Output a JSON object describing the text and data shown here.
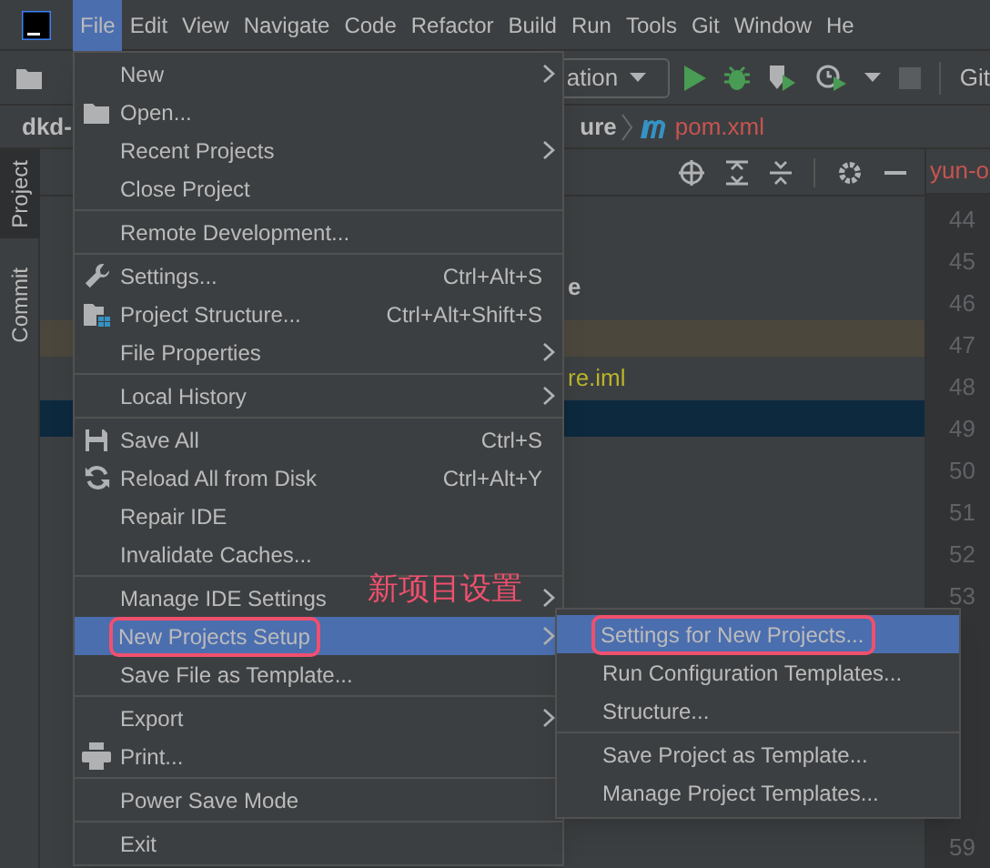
{
  "menubar": [
    {
      "label": "File",
      "selected": true
    },
    {
      "label": "Edit",
      "selected": false
    },
    {
      "label": "View",
      "selected": false
    },
    {
      "label": "Navigate",
      "selected": false
    },
    {
      "label": "Code",
      "selected": false
    },
    {
      "label": "Refactor",
      "selected": false
    },
    {
      "label": "Build",
      "selected": false
    },
    {
      "label": "Run",
      "selected": false
    },
    {
      "label": "Tools",
      "selected": false
    },
    {
      "label": "Git",
      "selected": false
    },
    {
      "label": "Window",
      "selected": false
    },
    {
      "label": "He",
      "selected": false
    }
  ],
  "toolbar": {
    "run_config": "ation",
    "vcs": "Git"
  },
  "breadcrumb": {
    "project": "dkd-",
    "module": "ure",
    "file": "pom.xml"
  },
  "tool_strip": [
    {
      "label": "Project",
      "selected": true
    },
    {
      "label": "Commit",
      "selected": false
    }
  ],
  "project_panel": {
    "rows": [
      {
        "text": "e",
        "kind": "bold"
      },
      {
        "kind": "modified"
      },
      {
        "text": "re.iml",
        "kind": "iml"
      },
      {
        "kind": "selected"
      }
    ]
  },
  "editor": {
    "tab": "yun-o",
    "line_numbers": [
      "44",
      "45",
      "46",
      "47",
      "48",
      "49",
      "50",
      "51",
      "52",
      "53"
    ],
    "last_line": "59"
  },
  "file_menu": [
    {
      "kind": "item",
      "label": "New",
      "submenu": true,
      "selected": false
    },
    {
      "kind": "item",
      "label": "Open...",
      "selected": false
    },
    {
      "kind": "item",
      "label": "Recent Projects",
      "submenu": true,
      "selected": false
    },
    {
      "kind": "item",
      "label": "Close Project",
      "selected": false
    },
    {
      "kind": "separator"
    },
    {
      "kind": "item",
      "label": "Remote Development...",
      "selected": false
    },
    {
      "kind": "separator"
    },
    {
      "kind": "item",
      "label": "Settings...",
      "shortcut": "Ctrl+Alt+S",
      "selected": false
    },
    {
      "kind": "item",
      "label": "Project Structure...",
      "shortcut": "Ctrl+Alt+Shift+S",
      "selected": false
    },
    {
      "kind": "item",
      "label": "File Properties",
      "submenu": true,
      "selected": false
    },
    {
      "kind": "separator"
    },
    {
      "kind": "item",
      "label": "Local History",
      "submenu": true,
      "selected": false
    },
    {
      "kind": "separator"
    },
    {
      "kind": "item",
      "label": "Save All",
      "shortcut": "Ctrl+S",
      "selected": false
    },
    {
      "kind": "item",
      "label": "Reload All from Disk",
      "shortcut": "Ctrl+Alt+Y",
      "selected": false
    },
    {
      "kind": "item",
      "label": "Repair IDE",
      "selected": false
    },
    {
      "kind": "item",
      "label": "Invalidate Caches...",
      "selected": false
    },
    {
      "kind": "separator"
    },
    {
      "kind": "item",
      "label": "Manage IDE Settings",
      "submenu": true,
      "selected": false
    },
    {
      "kind": "item",
      "label": "New Projects Setup",
      "submenu": true,
      "selected": true,
      "marked": true
    },
    {
      "kind": "item",
      "label": "Save File as Template...",
      "selected": false
    },
    {
      "kind": "separator"
    },
    {
      "kind": "item",
      "label": "Export",
      "submenu": true,
      "selected": false
    },
    {
      "kind": "item",
      "label": "Print...",
      "selected": false
    },
    {
      "kind": "separator"
    },
    {
      "kind": "item",
      "label": "Power Save Mode",
      "selected": false
    },
    {
      "kind": "separator"
    },
    {
      "kind": "item",
      "label": "Exit",
      "selected": false
    }
  ],
  "submenu": [
    {
      "kind": "item",
      "label": "Settings for New Projects...",
      "selected": true,
      "marked": true
    },
    {
      "kind": "item",
      "label": "Run Configuration Templates...",
      "selected": false
    },
    {
      "kind": "item",
      "label": "Structure...",
      "selected": false
    },
    {
      "kind": "separator"
    },
    {
      "kind": "item",
      "label": "Save Project as Template...",
      "selected": false
    },
    {
      "kind": "item",
      "label": "Manage Project Templates...",
      "selected": false
    }
  ],
  "annotation": "新项目设置"
}
